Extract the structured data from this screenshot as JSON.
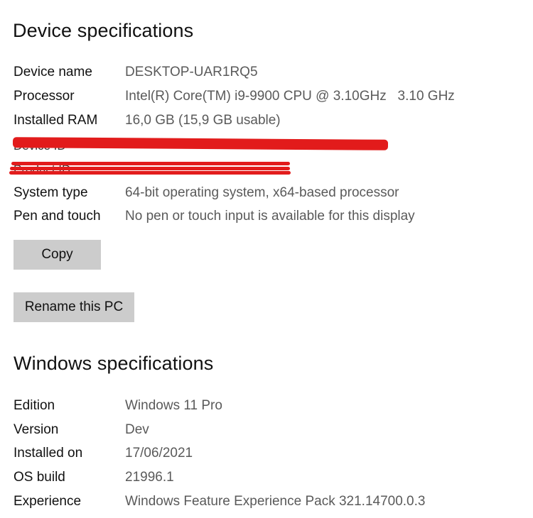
{
  "device_specs": {
    "title": "Device specifications",
    "rows": [
      {
        "label": "Device name",
        "value": "DESKTOP-UAR1RQ5"
      },
      {
        "label": "Processor",
        "value": "Intel(R) Core(TM) i9-9900 CPU @ 3.10GHz   3.10 GHz"
      },
      {
        "label": "Installed RAM",
        "value": "16,0 GB (15,9 GB usable)"
      },
      {
        "label": "Device ID",
        "value": "",
        "redacted": true
      },
      {
        "label": "Product ID",
        "value": "",
        "redacted": true
      },
      {
        "label": "System type",
        "value": "64-bit operating system, x64-based processor"
      },
      {
        "label": "Pen and touch",
        "value": "No pen or touch input is available for this display"
      }
    ],
    "copy_label": "Copy",
    "rename_label": "Rename this PC"
  },
  "windows_specs": {
    "title": "Windows specifications",
    "rows": [
      {
        "label": "Edition",
        "value": "Windows 11 Pro"
      },
      {
        "label": "Version",
        "value": "Dev"
      },
      {
        "label": "Installed on",
        "value": "17/06/2021"
      },
      {
        "label": "OS build",
        "value": "21996.1"
      },
      {
        "label": "Experience",
        "value": "Windows Feature Experience Pack 321.14700.0.3"
      }
    ]
  },
  "colors": {
    "redaction": "#e21c1c",
    "button_bg": "#cccccc",
    "value_text": "#5a5a5a"
  }
}
